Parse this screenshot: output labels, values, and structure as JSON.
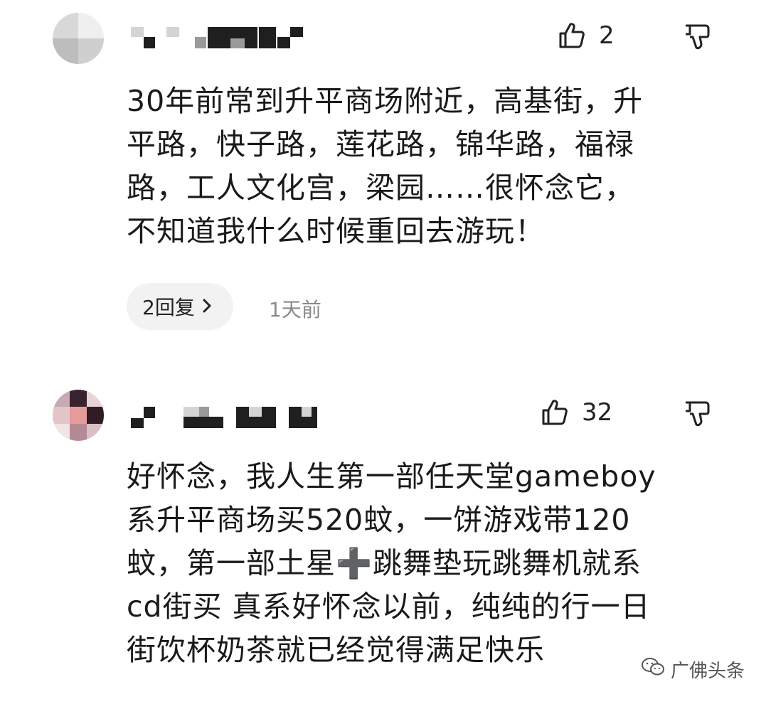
{
  "comments": [
    {
      "likes": "2",
      "lines": [
        "30年前常到升平商场附近，高基街，升",
        "平路，快子路，莲花路，锦华路，福禄",
        "路，工人文化宫，梁园……很怀念它，",
        "不知道我什么时候重回去游玩！"
      ],
      "replies_label": "2回复",
      "time": "1天前"
    },
    {
      "likes": "32",
      "lines": [
        "好怀念，我人生第一部任天堂gameboy",
        "系升平商场买520蚊，一饼游戏带120",
        "蚊，第一部土星➕跳舞垫玩跳舞机就系",
        "cd街买 真系好怀念以前，纯纯的行一日",
        "街饮杯奶茶就已经觉得满足快乐"
      ]
    }
  ],
  "watermark": {
    "label": "广佛头条",
    "icon": "wechat-icon"
  }
}
